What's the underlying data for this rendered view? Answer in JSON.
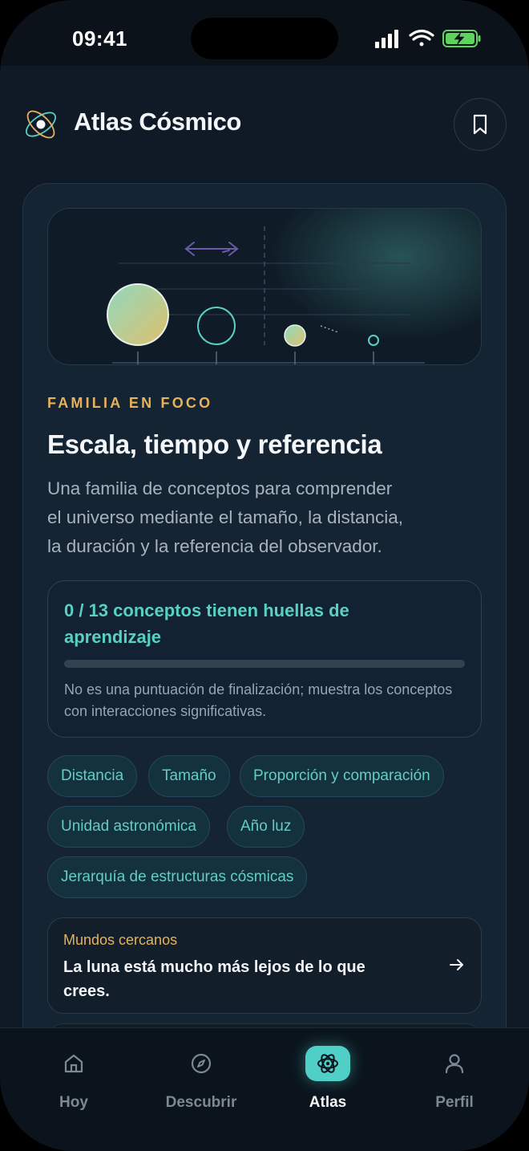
{
  "status_bar": {
    "time": "09:41"
  },
  "header": {
    "app_title": "Atlas Cósmico"
  },
  "focus": {
    "eyebrow": "FAMILIA EN FOCO",
    "title": "Escala, tiempo y referencia",
    "description_lines": [
      "Una familia de conceptos para comprender",
      "el universo mediante el tamaño, la distancia,",
      "la duración y la referencia del observador."
    ]
  },
  "progress": {
    "title": "0 / 13 conceptos tienen huellas de aprendizaje",
    "fraction": 0,
    "note": "No es una puntuación de finalización; muestra los conceptos con interacciones significativas."
  },
  "concepts": [
    "Distancia",
    "Tamaño",
    "Proporción y comparación",
    "Unidad astronómica",
    "Año luz",
    "Jerarquía de estructuras cósmicas"
  ],
  "story": {
    "kicker": "Mundos cercanos",
    "title": "La luna está mucho más lejos de lo que crees."
  },
  "tabs": [
    {
      "label": "Hoy",
      "icon": "home-icon",
      "active": false
    },
    {
      "label": "Descubrir",
      "icon": "compass-icon",
      "active": false
    },
    {
      "label": "Atlas",
      "icon": "atom-icon",
      "active": true
    },
    {
      "label": "Perfil",
      "icon": "user-icon",
      "active": false
    }
  ],
  "colors": {
    "accent": "#59d0c4",
    "gold": "#e7b25a",
    "background": "#0f1a26",
    "card": "#152433"
  }
}
